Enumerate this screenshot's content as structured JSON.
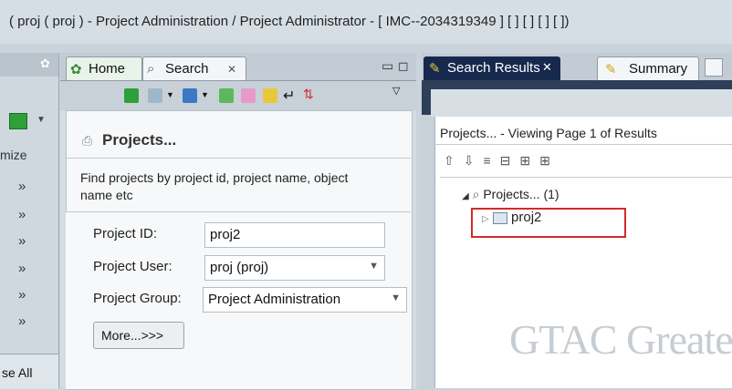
{
  "window_title": "( proj ( proj ) - Project Administration / Project Administrator - [ IMC--2034319349 ] [ ] [ ] [ ]  [  ])",
  "left_panel": {
    "minimize_label": "mize",
    "close_all_label": "se All"
  },
  "center_panel": {
    "tabs": [
      {
        "label": "Home"
      },
      {
        "label": "Search",
        "close": "✕"
      }
    ],
    "projects_header": "Projects...",
    "description": "Find projects by project id, project name, object name etc",
    "fields": {
      "project_id": {
        "label": "Project ID:",
        "value": "proj2"
      },
      "project_user": {
        "label": "Project User:",
        "value": "proj (proj)"
      },
      "project_group": {
        "label": "Project Group:",
        "value": "Project Administration"
      }
    },
    "more_button": "More...>>>"
  },
  "right_panel": {
    "tabs": [
      {
        "label": "Search Results",
        "close": "✕"
      },
      {
        "label": "Summary"
      }
    ],
    "viewing_text": "Projects... - Viewing Page 1 of Results",
    "tree": {
      "root_label": "Projects... (1)",
      "child_label": "proj2"
    }
  },
  "watermark": "GTAC Greater",
  "colors": {
    "active_tab": "#16294d",
    "highlight_box": "#d32a2a",
    "panel_bg": "#d4dde4"
  }
}
